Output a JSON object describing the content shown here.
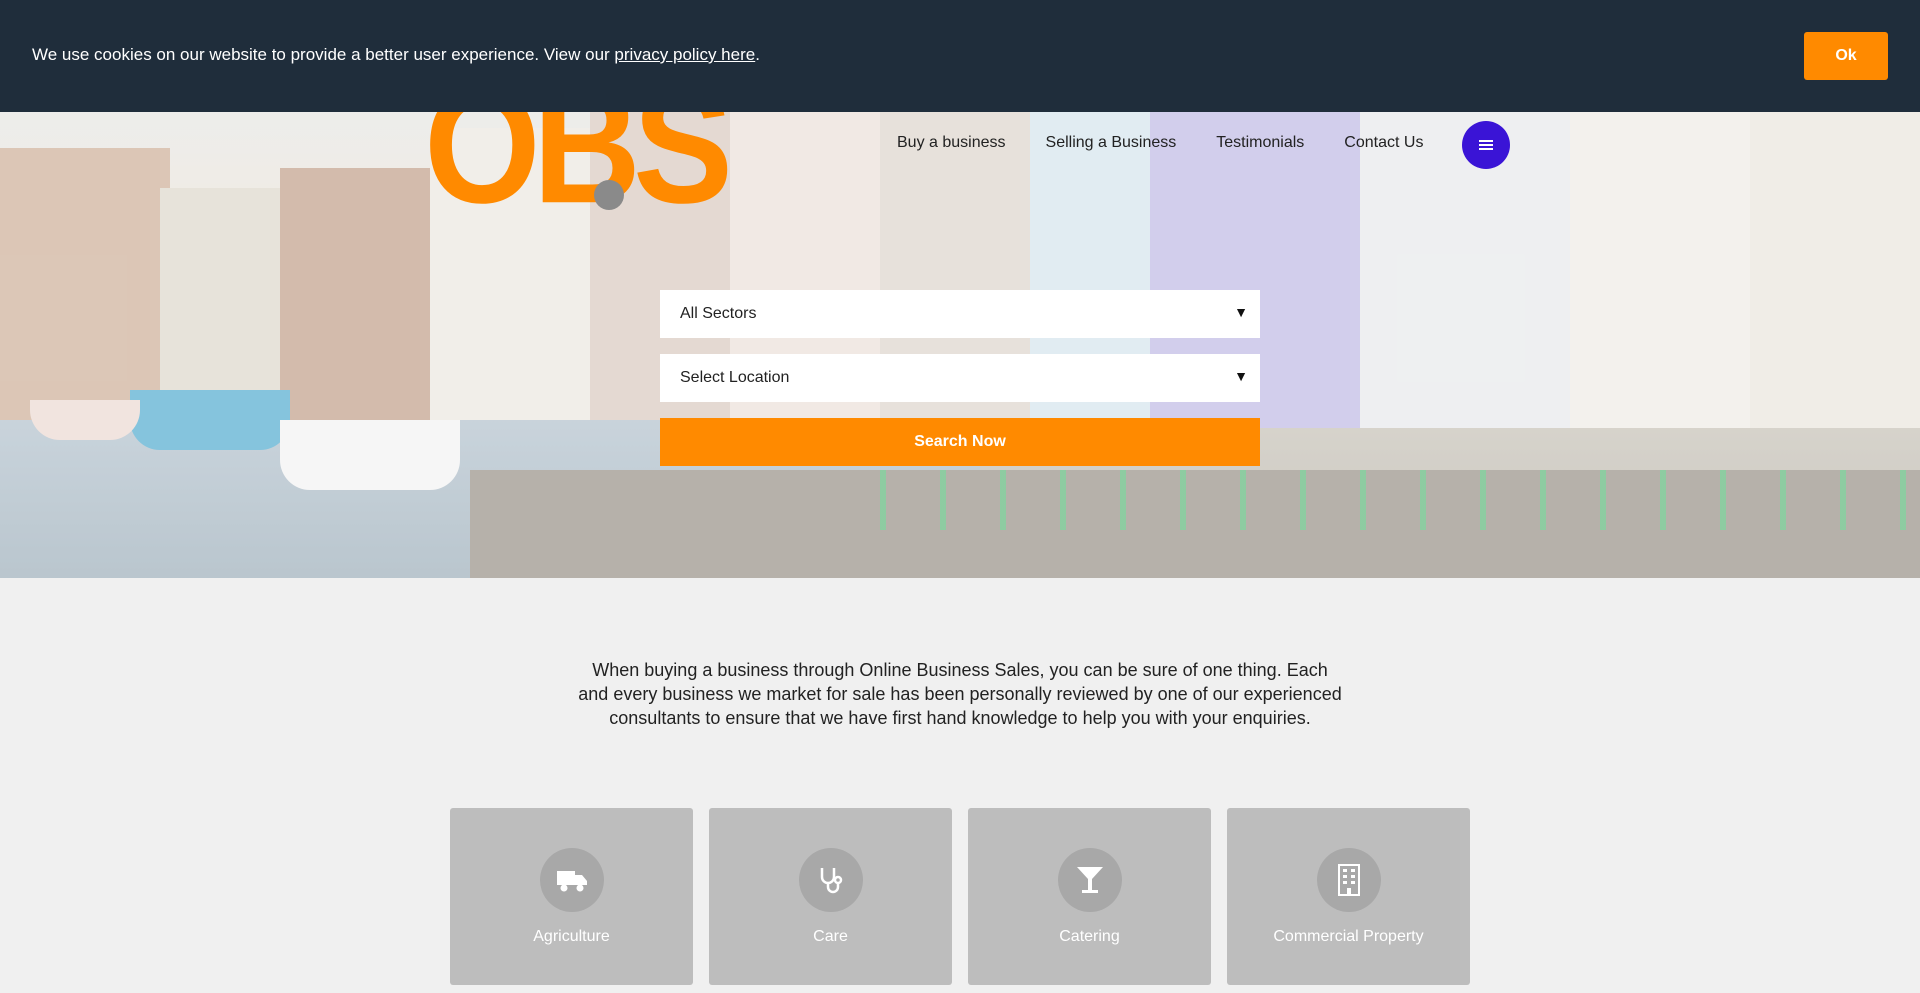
{
  "cookie_bar": {
    "text": "We use cookies on our website to provide a better user experience. View our ",
    "link": "privacy policy here",
    "suffix": ".",
    "ok_label": "Ok"
  },
  "logo": {
    "text": "OBS"
  },
  "nav": {
    "items": [
      "Buy a business",
      "Selling a Business",
      "Testimonials",
      "Contact Us"
    ],
    "menu_icon": "hamburger-icon"
  },
  "search": {
    "sector_value": "All Sectors",
    "location_value": "Select Location",
    "button_label": "Search Now"
  },
  "intro": {
    "text": "When buying a business through Online Business Sales, you can be sure of one thing. Each and every business we market for sale has been personally reviewed by one of our experienced consultants to ensure that we have first hand knowledge to help you with your enquiries."
  },
  "sectors": [
    {
      "label": "Agriculture",
      "icon": "truck-icon"
    },
    {
      "label": "Care",
      "icon": "stethoscope-icon"
    },
    {
      "label": "Catering",
      "icon": "cocktail-glass-icon"
    },
    {
      "label": "Commercial Property",
      "icon": "building-icon"
    }
  ],
  "colors": {
    "accent": "#ff8a00",
    "cookie_bar": "#1f2d3b",
    "menu_button": "#3a14d6",
    "card": "#bdbdbd"
  }
}
